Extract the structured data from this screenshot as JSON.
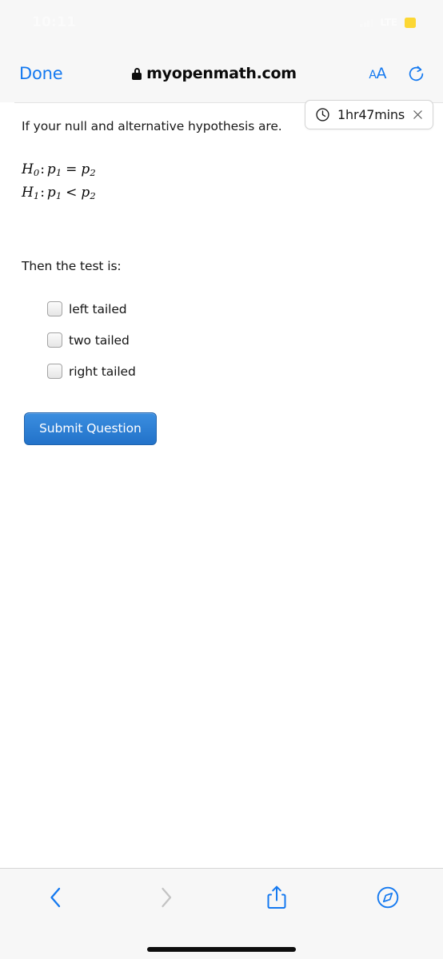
{
  "status_bar": {
    "time": "10:11",
    "signal_icon": "cellular-signal-icon",
    "network_label": "LTE",
    "battery_icon": "battery-icon",
    "battery_color": "#fcd734"
  },
  "browser_bar": {
    "done_label": "Done",
    "lock_icon": "lock-icon",
    "url": "myopenmath.com",
    "text_size_small": "A",
    "text_size_large": "A",
    "reload_icon": "reload-icon",
    "accent_color": "#1479f0"
  },
  "timer": {
    "clock_icon": "clock-icon",
    "label": "1hr47mins",
    "close_icon": "close-icon"
  },
  "question": {
    "prompt": "If your null and alternative hypothesis are.",
    "math": [
      {
        "hyp": "H",
        "hyp_sub": "0",
        "lhs": "p",
        "lhs_sub": "1",
        "operator": "=",
        "rhs": "p",
        "rhs_sub": "2"
      },
      {
        "hyp": "H",
        "hyp_sub": "1",
        "lhs": "p",
        "lhs_sub": "1",
        "operator": "<",
        "rhs": "p",
        "rhs_sub": "2"
      }
    ],
    "instruction": "Then the test is:",
    "options": [
      {
        "label": "left tailed",
        "checked": false
      },
      {
        "label": "two tailed",
        "checked": false
      },
      {
        "label": "right tailed",
        "checked": false
      }
    ],
    "submit_label": "Submit Question",
    "submit_color": "#2272c9"
  },
  "bottom_toolbar": {
    "back_icon": "chevron-left-icon",
    "forward_icon": "chevron-right-icon",
    "share_icon": "share-icon",
    "safari_icon": "safari-compass-icon",
    "active_color": "#1479f0",
    "disabled_color": "#c4c4c4"
  }
}
